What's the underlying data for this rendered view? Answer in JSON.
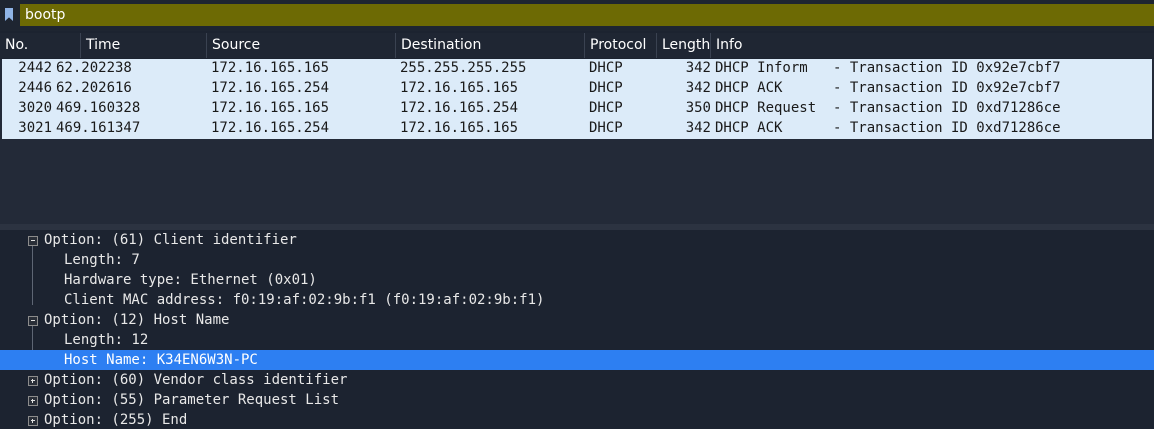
{
  "filter": {
    "value": "bootp"
  },
  "columns": [
    "No.",
    "Time",
    "Source",
    "Destination",
    "Protocol",
    "Length",
    "Info"
  ],
  "packets": [
    {
      "no": "2442",
      "time": "62.202238",
      "source": "172.16.165.165",
      "destination": "255.255.255.255",
      "protocol": "DHCP",
      "length": "342",
      "info": "DHCP Inform   - Transaction ID 0x92e7cbf7"
    },
    {
      "no": "2446",
      "time": "62.202616",
      "source": "172.16.165.254",
      "destination": "172.16.165.165",
      "protocol": "DHCP",
      "length": "342",
      "info": "DHCP ACK      - Transaction ID 0x92e7cbf7"
    },
    {
      "no": "3020",
      "time": "469.160328",
      "source": "172.16.165.165",
      "destination": "172.16.165.254",
      "protocol": "DHCP",
      "length": "350",
      "info": "DHCP Request  - Transaction ID 0xd71286ce"
    },
    {
      "no": "3021",
      "time": "469.161347",
      "source": "172.16.165.254",
      "destination": "172.16.165.165",
      "protocol": "DHCP",
      "length": "342",
      "info": "DHCP ACK      - Transaction ID 0xd71286ce"
    }
  ],
  "details": [
    {
      "text": "Option: (61) Client identifier",
      "expander": "collapse"
    },
    {
      "text": "Length: 7",
      "expander": ""
    },
    {
      "text": "Hardware type: Ethernet (0x01)",
      "expander": ""
    },
    {
      "text": "Client MAC address: f0:19:af:02:9b:f1 (f0:19:af:02:9b:f1)",
      "expander": ""
    },
    {
      "text": "Option: (12) Host Name",
      "expander": "collapse"
    },
    {
      "text": "Length: 12",
      "expander": ""
    },
    {
      "text": "Host Name: K34EN6W3N-PC",
      "expander": "",
      "selected": true
    },
    {
      "text": "Option: (60) Vendor class identifier",
      "expander": "expand"
    },
    {
      "text": "Option: (55) Parameter Request List",
      "expander": "expand"
    },
    {
      "text": "Option: (255) End",
      "expander": "expand"
    }
  ],
  "colors": {
    "filter_bg": "#6d6a04",
    "row_bg": "#dcebf9",
    "selected_bg": "#2d7ff2"
  }
}
